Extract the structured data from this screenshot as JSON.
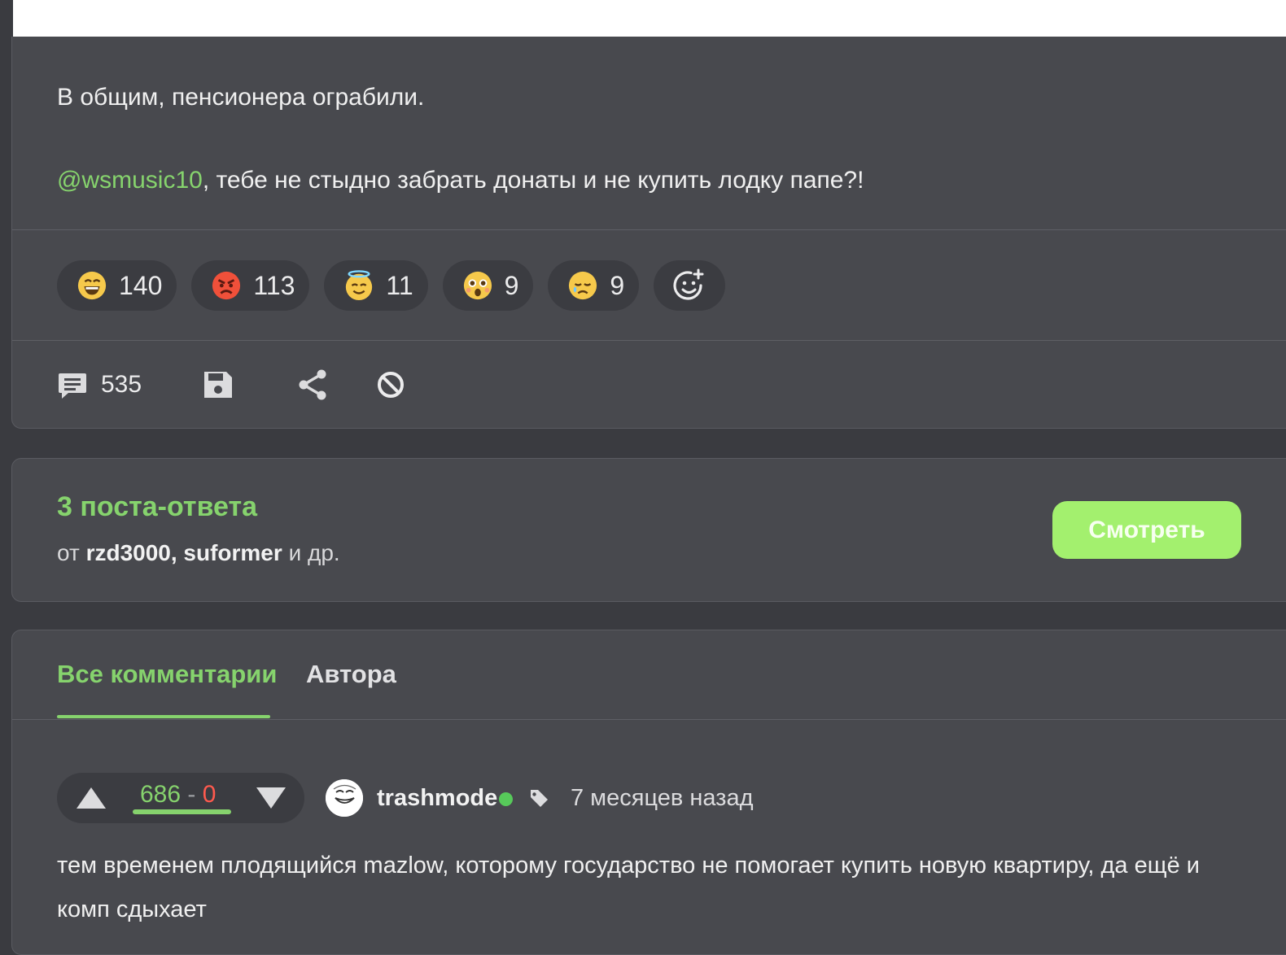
{
  "post": {
    "text_line1": "В общим, пенсионера ограбили.",
    "mention": "@wsmusic10",
    "text_line2_rest": ", тебе не стыдно забрать донаты и не купить лодку папе?!",
    "reactions": [
      {
        "icon": "laughing-emoji-icon",
        "count": "140"
      },
      {
        "icon": "angry-emoji-icon",
        "count": "113"
      },
      {
        "icon": "angel-emoji-icon",
        "count": "11"
      },
      {
        "icon": "shocked-emoji-icon",
        "count": "9"
      },
      {
        "icon": "sad-emoji-icon",
        "count": "9"
      }
    ],
    "add_reaction_icon": "add-reaction-icon",
    "comments_count": "535",
    "action_icons": [
      "comment-icon",
      "save-icon",
      "share-icon",
      "block-icon"
    ]
  },
  "replies": {
    "title": "3 поста-ответа",
    "from_prefix": "от",
    "authors": "rzd3000, suformer",
    "suffix": "и др.",
    "view_button": "Смотреть"
  },
  "comments": {
    "tabs": [
      {
        "label": "Все комментарии",
        "active": true
      },
      {
        "label": "Автора",
        "active": false
      }
    ],
    "items": [
      {
        "score_plus": "686",
        "score_separator": "-",
        "score_minus": "0",
        "author": "trashmode",
        "online": true,
        "time": "7 месяцев назад",
        "text": "тем временем плодящийся mazlow, которому государство не помогает купить новую квартиру, да ещё и комп сдыхает"
      }
    ]
  },
  "colors": {
    "accent_green": "#86d36d",
    "button_green": "#a3f06e",
    "card_bg": "#48494e",
    "page_bg": "#3a3b40",
    "negative": "#ff5a4e",
    "online": "#57c95a"
  }
}
